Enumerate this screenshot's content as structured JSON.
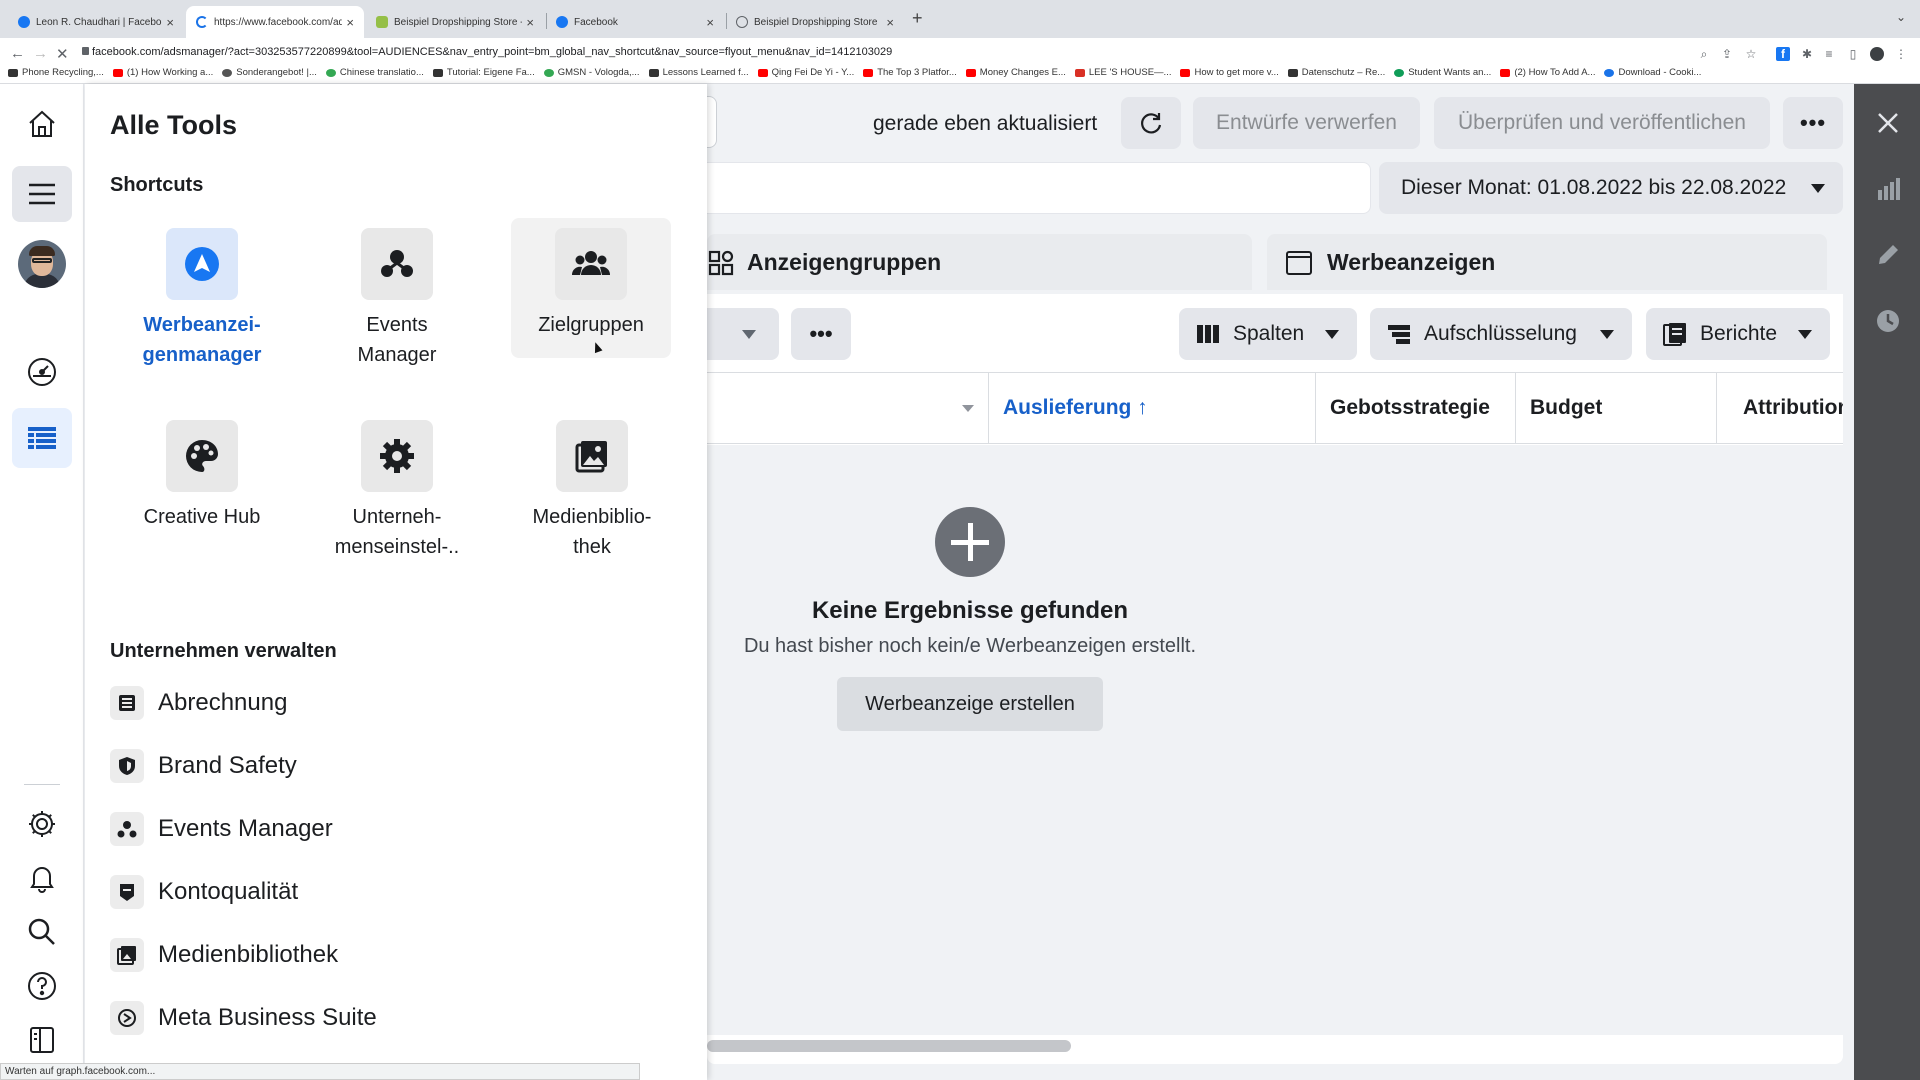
{
  "browser": {
    "tabs": [
      {
        "title": "Leon R. Chaudhari | Facebook",
        "favicon_color": "#1877f2"
      },
      {
        "title": "https://www.facebook.com/ad",
        "favicon_color": "#1a73e8"
      },
      {
        "title": "Beispiel Dropshipping Store - F",
        "favicon_color": "#95bf47"
      },
      {
        "title": "Facebook",
        "favicon_color": "#1877f2"
      },
      {
        "title": "Beispiel Dropshipping Store",
        "favicon_color": "#5f6368"
      }
    ],
    "url": "facebook.com/adsmanager/?act=303253577220899&tool=AUDIENCES&nav_entry_point=bm_global_nav_shortcut&nav_source=flyout_menu&nav_id=1412103029",
    "bookmarks": [
      {
        "label": "Phone Recycling,...",
        "color": "#333"
      },
      {
        "label": "(1) How Working a...",
        "color": "#ff0000"
      },
      {
        "label": "Sonderangebot! |...",
        "color": "#555"
      },
      {
        "label": "Chinese translatio...",
        "color": "#34a853"
      },
      {
        "label": "Tutorial: Eigene Fa...",
        "color": "#333"
      },
      {
        "label": "GMSN - Vologda,...",
        "color": "#34a853"
      },
      {
        "label": "Lessons Learned f...",
        "color": "#333"
      },
      {
        "label": "Qing Fei De Yi - Y...",
        "color": "#ff0000"
      },
      {
        "label": "The Top 3 Platfor...",
        "color": "#ff0000"
      },
      {
        "label": "Money Changes E...",
        "color": "#ff0000"
      },
      {
        "label": "LEE 'S HOUSE—...",
        "color": "#d93025"
      },
      {
        "label": "How to get more v...",
        "color": "#ff0000"
      },
      {
        "label": "Datenschutz – Re...",
        "color": "#333"
      },
      {
        "label": "Student Wants an...",
        "color": "#0f9d58"
      },
      {
        "label": "(2) How To Add A...",
        "color": "#ff0000"
      },
      {
        "label": "Download - Cooki...",
        "color": "#1a73e8"
      }
    ],
    "status_text": "Warten auf graph.facebook.com..."
  },
  "flyout": {
    "title": "Alle Tools",
    "shortcuts_title": "Shortcuts",
    "shortcuts": [
      {
        "label": "Werbeanzei-\ngenmanager",
        "icon": "ads-manager-icon"
      },
      {
        "label": "Events\nManager",
        "icon": "events-manager-icon"
      },
      {
        "label": "Zielgruppen",
        "icon": "audiences-icon"
      },
      {
        "label": "Creative Hub",
        "icon": "palette-icon"
      },
      {
        "label": "Unterneh-\nmenseinstel-..",
        "icon": "gear-icon"
      },
      {
        "label": "Medienbiblio-\nthek",
        "icon": "media-library-icon"
      }
    ],
    "manage_title": "Unternehmen verwalten",
    "manage_items": [
      {
        "label": "Abrechnung",
        "icon": "billing-icon"
      },
      {
        "label": "Brand Safety",
        "icon": "shield-icon"
      },
      {
        "label": "Events Manager",
        "icon": "events-manager-icon"
      },
      {
        "label": "Kontoqualität",
        "icon": "account-quality-icon"
      },
      {
        "label": "Medienbibliothek",
        "icon": "media-library-icon"
      },
      {
        "label": "Meta Business Suite",
        "icon": "meta-business-suite-icon"
      }
    ]
  },
  "toolbar": {
    "updated_text": "gerade eben aktualisiert",
    "discard_label": "Entwürfe verwerfen",
    "publish_label": "Überprüfen und veröffentlichen",
    "date_range_label": "Dieser Monat: 01.08.2022 bis 22.08.2022"
  },
  "tabs": {
    "adsets_label": "Anzeigengruppen",
    "ads_label": "Werbeanzeigen"
  },
  "table": {
    "buttons": {
      "columns_label": "Spalten",
      "breakdown_label": "Aufschlüsselung",
      "reports_label": "Berichte"
    },
    "headers": [
      "Auslieferung ↑",
      "Gebotsstrategie",
      "Budget",
      "Attribution"
    ],
    "empty_title": "Keine Ergebnisse gefunden",
    "empty_subtitle": "Du hast bisher noch kein/e Werbeanzeigen erstellt.",
    "create_button_label": "Werbeanzeige erstellen"
  },
  "colors": {
    "accent_blue": "#1760c9",
    "right_sidebar": "#4b4c4f"
  }
}
